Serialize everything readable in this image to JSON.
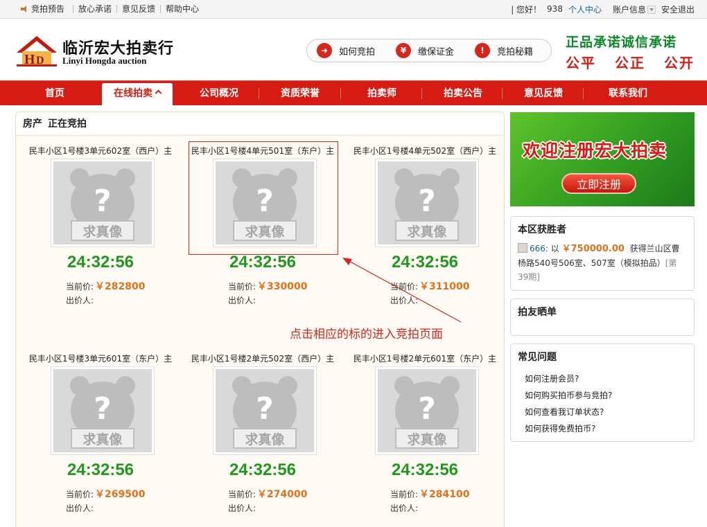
{
  "topbar": {
    "preview": "竞拍预告",
    "links": [
      "放心承诺",
      "意见反馈",
      "帮助中心"
    ],
    "greeting": "|  您好！",
    "username": "938",
    "personal": "个人中心",
    "account": "账户信息",
    "logout": "安全退出"
  },
  "header": {
    "logo_cn": "临沂宏大拍卖行",
    "logo_en": "Linyi Hongda auction",
    "pills": [
      {
        "label": "如何竞拍",
        "icon": "arrow-icon"
      },
      {
        "label": "缴保证金",
        "icon": "yen-icon"
      },
      {
        "label": "竞拍秘籍",
        "icon": "thermometer-icon"
      }
    ],
    "slogan_line1": "正品承诺诚信承诺",
    "slogan_line2": [
      "公平",
      "公正",
      "公开"
    ]
  },
  "nav": {
    "items": [
      "首页",
      "在线拍卖",
      "公司概况",
      "资质荣誉",
      "拍卖师",
      "拍卖公告",
      "意见反馈",
      "联系我们"
    ],
    "active_index": 1
  },
  "main": {
    "category": "房产",
    "status": "正在竞拍",
    "price_label": "当前价:",
    "bidder_label": "出价人:",
    "placeholder_text": "求真像",
    "lots": [
      {
        "title": "民丰小区1号楼3单元602室（西户）主",
        "timer": "24:32:56",
        "price": "￥282800"
      },
      {
        "title": "民丰小区1号楼4单元501室（东户）主",
        "timer": "24:32:56",
        "price": "￥330000"
      },
      {
        "title": "民丰小区1号楼4单元502室（西户）主",
        "timer": "24:32:56",
        "price": "￥311000"
      },
      {
        "title": "民丰小区1号楼3单元601室（东户）主",
        "timer": "24:32:56",
        "price": "￥269500"
      },
      {
        "title": "民丰小区1号楼2单元502室（西户）主",
        "timer": "24:32:56",
        "price": "￥274000"
      },
      {
        "title": "民丰小区1号楼2单元601室（东户）主",
        "timer": "24:32:56",
        "price": "￥284100"
      }
    ],
    "annotation": "点击相应的标的进入竞拍页面"
  },
  "sidebar": {
    "banner_text": "欢迎注册宏大拍卖",
    "banner_button": "立即注册",
    "winners_title": "本区获胜者",
    "winner_name": "666:",
    "winner_prefix": "以",
    "winner_amount": "￥750000.00",
    "winner_desc": "获得兰山区曹杨路540号506室、507室（模拟拍品）",
    "winner_session": "[第39期]",
    "showcase_title": "拍友晒单",
    "faq_title": "常见问题",
    "faq": [
      "如何注册会员?",
      "如何购买拍币参与竞拍?",
      "如何查看我订单状态?",
      "如何获得免费拍币?"
    ]
  },
  "colors": {
    "nav_red": "#d61c12",
    "timer_green": "#1d9a1d",
    "price_orange": "#e2701a",
    "link_blue": "#1a5fa8"
  }
}
